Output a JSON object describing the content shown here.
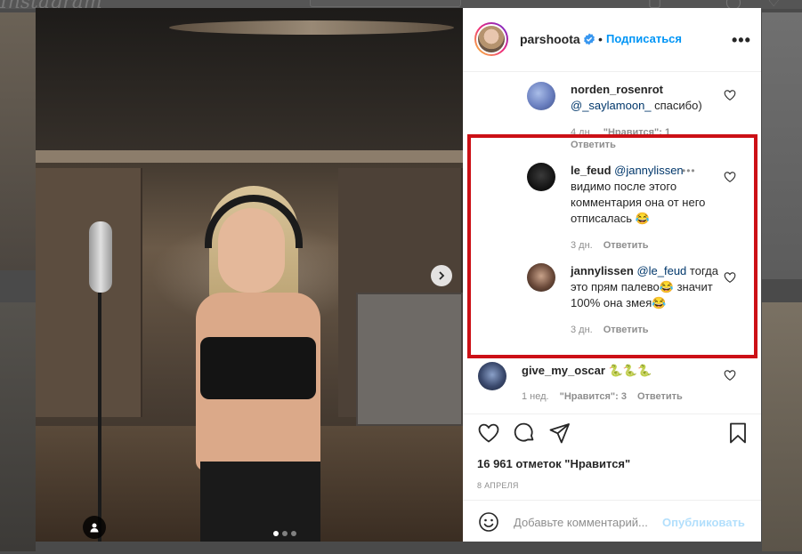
{
  "background": {
    "logo_text": "Instagram"
  },
  "post": {
    "carousel": {
      "total_slides": 3,
      "active_slide": 1
    }
  },
  "header": {
    "username": "parshoota",
    "verified": true,
    "separator": "•",
    "follow_label": "Подписаться",
    "more_label": "•••"
  },
  "comments": [
    {
      "username": "norden_rosenrot",
      "mention": "@_saylamoon_",
      "text": " спасибо)",
      "time": "4 дн.",
      "likes_label": "\"Нравится\": 1",
      "reply_label": "Ответить"
    },
    {
      "username": "le_feud",
      "mention": "@jannylissen",
      "text": " видимо после этого комментария она от него отписалась 😂",
      "time": "3 дн.",
      "reply_label": "Ответить"
    },
    {
      "username": "jannylissen",
      "mention": "@le_feud",
      "text": " тогда это прям палево😂 значит 100% она змея😂",
      "time": "3 дн.",
      "reply_label": "Ответить"
    },
    {
      "username": "give_my_oscar",
      "text": " 🐍🐍🐍",
      "time": "1 нед.",
      "likes_label": "\"Нравится\": 3",
      "reply_label": "Ответить"
    }
  ],
  "comment_more_label": "•••",
  "actions": {
    "likes_text": "16 961 отметок \"Нравится\"",
    "date_text": "8 АПРЕЛЯ"
  },
  "add_comment": {
    "placeholder": "Добавьте комментарий...",
    "publish_label": "Опубликовать"
  },
  "colors": {
    "accent": "#0095f6",
    "highlight_box": "#cc1016",
    "mention": "#00376b",
    "muted": "#8e8e8e"
  }
}
